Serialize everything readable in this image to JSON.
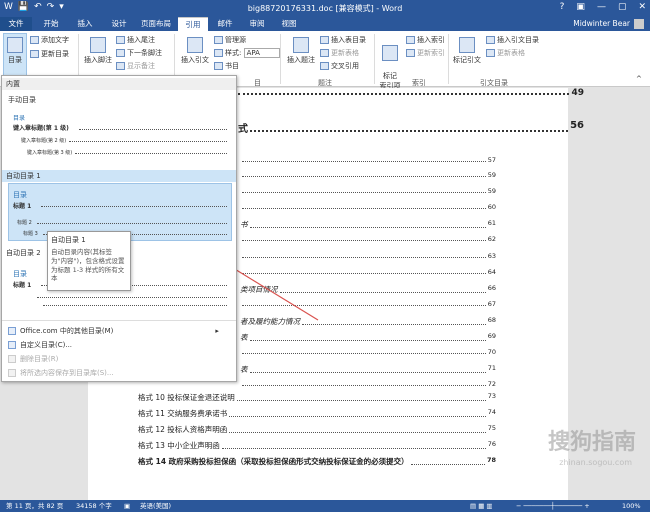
{
  "titlebar": {
    "title": "big88720176331.doc [兼容模式] - Word",
    "qat": [
      "W",
      "💾",
      "↶",
      "↷",
      "▾"
    ],
    "window_buttons": [
      "?",
      "▣",
      "—",
      "▢",
      "✕"
    ]
  },
  "tabs": [
    "文件",
    "开始",
    "插入",
    "设计",
    "页面布局",
    "引用",
    "邮件",
    "审阅",
    "视图"
  ],
  "user": {
    "name": "Midwinter Bear"
  },
  "ribbon": {
    "toc_button": "目录",
    "add_text": "添加文字",
    "update_toc": "更新目录",
    "insert_footnote": "插入脚注",
    "insert_endnote": "插入尾注",
    "next_footnote": "下一条脚注",
    "show_notes": "显示备注",
    "insert_citation": "插入引文",
    "manage_sources": "管理源",
    "style_label": "样式:",
    "style_value": "APA",
    "bibliography": "书目",
    "insert_caption": "插入题注",
    "insert_table_of_figures": "插入表目录",
    "update_table": "更新表格",
    "cross_reference": "交叉引用",
    "mark_entry": "标记\n索引项",
    "insert_index": "插入索引",
    "update_index": "更新索引",
    "mark_citation": "标记引文",
    "insert_toa": "插入引文目录",
    "update_toa": "更新表格",
    "group_captions": "题注",
    "group_index": "索引",
    "group_toa": "引文目录",
    "group_citations": "目"
  },
  "toc_dropdown": {
    "section_builtin": "内置",
    "manual_toc": "手动目录",
    "manual_title": "目录",
    "manual_line1": "键入章标题(第 1 级)",
    "manual_line2": "键入章标题(第 2 级)",
    "manual_line3": "键入章标题(第 3 级)",
    "auto1": "自动目录 1",
    "auto1_title": "目录",
    "auto1_l1": "标题 1",
    "auto1_l2": "标题 2",
    "auto1_l3": "标题 3",
    "auto2": "自动目录 2",
    "auto2_title": "目录",
    "auto2_l1": "标题 1",
    "menu_more": "Office.com 中的其他目录(M)",
    "menu_custom": "自定义目录(C)...",
    "menu_remove": "删除目录(R)",
    "menu_save": "将所选内容保存到目录库(S)..."
  },
  "tooltip": {
    "title": "自动目录 1",
    "body": "自动目录内容(其标签为\"内容\")，包含格式设置为标题 1-3 样式的所有文本"
  },
  "document": {
    "heading_page": "49",
    "heading2": "式",
    "heading2_page": "56",
    "entries": [
      {
        "text": "",
        "page": "57"
      },
      {
        "text": "",
        "page": "59"
      },
      {
        "text": "",
        "page": "59"
      },
      {
        "text": "",
        "page": "60"
      },
      {
        "text": "书",
        "page": "61"
      },
      {
        "text": "",
        "page": "62"
      },
      {
        "text": "",
        "page": "63"
      },
      {
        "text": "",
        "page": "64"
      },
      {
        "text": "类项目情况",
        "page": "66"
      },
      {
        "text": "",
        "page": "67"
      },
      {
        "text": "者及履约能力情况",
        "page": "68"
      },
      {
        "text": "表",
        "page": "69"
      },
      {
        "text": "",
        "page": "70"
      },
      {
        "text": "表",
        "page": "71"
      },
      {
        "text": "",
        "page": "72"
      }
    ],
    "lower_entries": [
      {
        "text": "格式 10 投标保证金退还说明",
        "page": "73"
      },
      {
        "text": "格式 11 交纳服务费承诺书",
        "page": "74"
      },
      {
        "text": "格式 12 投标人资格声明函",
        "page": "75"
      },
      {
        "text": "格式 13 中小企业声明函",
        "page": "76"
      },
      {
        "text": "格式 14 政府采购投标担保函（采取投标担保函形式交纳投标保证金的必须提交）",
        "page": "78"
      }
    ]
  },
  "statusbar": {
    "page": "第 11 页，共 82 页",
    "words": "34158 个字",
    "lang": "英语(美国)",
    "zoom": "100%"
  },
  "watermark": {
    "text": "搜狗指南",
    "url": "zhinan.sogou.com"
  },
  "colors": {
    "accent": "#2b579a",
    "selection": "#cde4f7",
    "arrow": "#d9534f"
  }
}
